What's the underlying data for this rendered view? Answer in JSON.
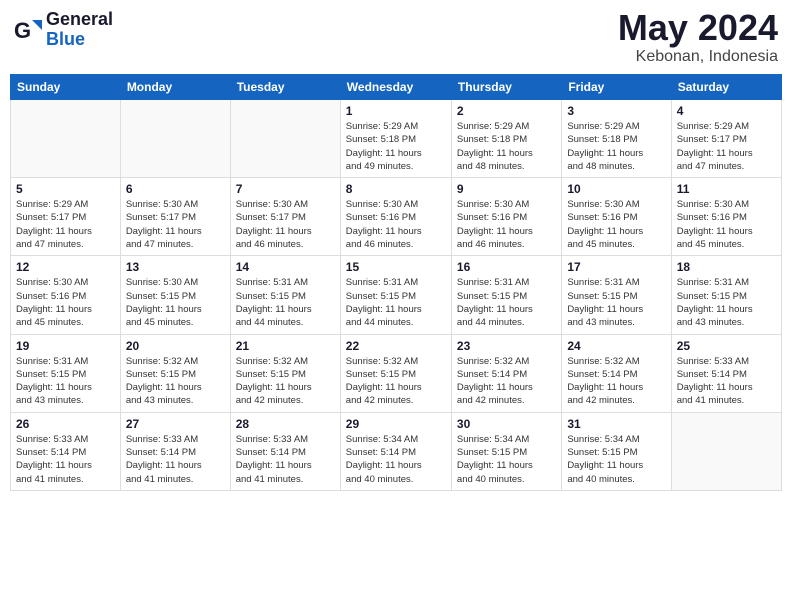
{
  "header": {
    "logo_general": "General",
    "logo_blue": "Blue",
    "title": "May 2024",
    "location": "Kebonan, Indonesia"
  },
  "days_of_week": [
    "Sunday",
    "Monday",
    "Tuesday",
    "Wednesday",
    "Thursday",
    "Friday",
    "Saturday"
  ],
  "weeks": [
    [
      {
        "day": "",
        "info": ""
      },
      {
        "day": "",
        "info": ""
      },
      {
        "day": "",
        "info": ""
      },
      {
        "day": "1",
        "info": "Sunrise: 5:29 AM\nSunset: 5:18 PM\nDaylight: 11 hours\nand 49 minutes."
      },
      {
        "day": "2",
        "info": "Sunrise: 5:29 AM\nSunset: 5:18 PM\nDaylight: 11 hours\nand 48 minutes."
      },
      {
        "day": "3",
        "info": "Sunrise: 5:29 AM\nSunset: 5:18 PM\nDaylight: 11 hours\nand 48 minutes."
      },
      {
        "day": "4",
        "info": "Sunrise: 5:29 AM\nSunset: 5:17 PM\nDaylight: 11 hours\nand 47 minutes."
      }
    ],
    [
      {
        "day": "5",
        "info": "Sunrise: 5:29 AM\nSunset: 5:17 PM\nDaylight: 11 hours\nand 47 minutes."
      },
      {
        "day": "6",
        "info": "Sunrise: 5:30 AM\nSunset: 5:17 PM\nDaylight: 11 hours\nand 47 minutes."
      },
      {
        "day": "7",
        "info": "Sunrise: 5:30 AM\nSunset: 5:17 PM\nDaylight: 11 hours\nand 46 minutes."
      },
      {
        "day": "8",
        "info": "Sunrise: 5:30 AM\nSunset: 5:16 PM\nDaylight: 11 hours\nand 46 minutes."
      },
      {
        "day": "9",
        "info": "Sunrise: 5:30 AM\nSunset: 5:16 PM\nDaylight: 11 hours\nand 46 minutes."
      },
      {
        "day": "10",
        "info": "Sunrise: 5:30 AM\nSunset: 5:16 PM\nDaylight: 11 hours\nand 45 minutes."
      },
      {
        "day": "11",
        "info": "Sunrise: 5:30 AM\nSunset: 5:16 PM\nDaylight: 11 hours\nand 45 minutes."
      }
    ],
    [
      {
        "day": "12",
        "info": "Sunrise: 5:30 AM\nSunset: 5:16 PM\nDaylight: 11 hours\nand 45 minutes."
      },
      {
        "day": "13",
        "info": "Sunrise: 5:30 AM\nSunset: 5:15 PM\nDaylight: 11 hours\nand 45 minutes."
      },
      {
        "day": "14",
        "info": "Sunrise: 5:31 AM\nSunset: 5:15 PM\nDaylight: 11 hours\nand 44 minutes."
      },
      {
        "day": "15",
        "info": "Sunrise: 5:31 AM\nSunset: 5:15 PM\nDaylight: 11 hours\nand 44 minutes."
      },
      {
        "day": "16",
        "info": "Sunrise: 5:31 AM\nSunset: 5:15 PM\nDaylight: 11 hours\nand 44 minutes."
      },
      {
        "day": "17",
        "info": "Sunrise: 5:31 AM\nSunset: 5:15 PM\nDaylight: 11 hours\nand 43 minutes."
      },
      {
        "day": "18",
        "info": "Sunrise: 5:31 AM\nSunset: 5:15 PM\nDaylight: 11 hours\nand 43 minutes."
      }
    ],
    [
      {
        "day": "19",
        "info": "Sunrise: 5:31 AM\nSunset: 5:15 PM\nDaylight: 11 hours\nand 43 minutes."
      },
      {
        "day": "20",
        "info": "Sunrise: 5:32 AM\nSunset: 5:15 PM\nDaylight: 11 hours\nand 43 minutes."
      },
      {
        "day": "21",
        "info": "Sunrise: 5:32 AM\nSunset: 5:15 PM\nDaylight: 11 hours\nand 42 minutes."
      },
      {
        "day": "22",
        "info": "Sunrise: 5:32 AM\nSunset: 5:15 PM\nDaylight: 11 hours\nand 42 minutes."
      },
      {
        "day": "23",
        "info": "Sunrise: 5:32 AM\nSunset: 5:14 PM\nDaylight: 11 hours\nand 42 minutes."
      },
      {
        "day": "24",
        "info": "Sunrise: 5:32 AM\nSunset: 5:14 PM\nDaylight: 11 hours\nand 42 minutes."
      },
      {
        "day": "25",
        "info": "Sunrise: 5:33 AM\nSunset: 5:14 PM\nDaylight: 11 hours\nand 41 minutes."
      }
    ],
    [
      {
        "day": "26",
        "info": "Sunrise: 5:33 AM\nSunset: 5:14 PM\nDaylight: 11 hours\nand 41 minutes."
      },
      {
        "day": "27",
        "info": "Sunrise: 5:33 AM\nSunset: 5:14 PM\nDaylight: 11 hours\nand 41 minutes."
      },
      {
        "day": "28",
        "info": "Sunrise: 5:33 AM\nSunset: 5:14 PM\nDaylight: 11 hours\nand 41 minutes."
      },
      {
        "day": "29",
        "info": "Sunrise: 5:34 AM\nSunset: 5:14 PM\nDaylight: 11 hours\nand 40 minutes."
      },
      {
        "day": "30",
        "info": "Sunrise: 5:34 AM\nSunset: 5:15 PM\nDaylight: 11 hours\nand 40 minutes."
      },
      {
        "day": "31",
        "info": "Sunrise: 5:34 AM\nSunset: 5:15 PM\nDaylight: 11 hours\nand 40 minutes."
      },
      {
        "day": "",
        "info": ""
      }
    ]
  ]
}
